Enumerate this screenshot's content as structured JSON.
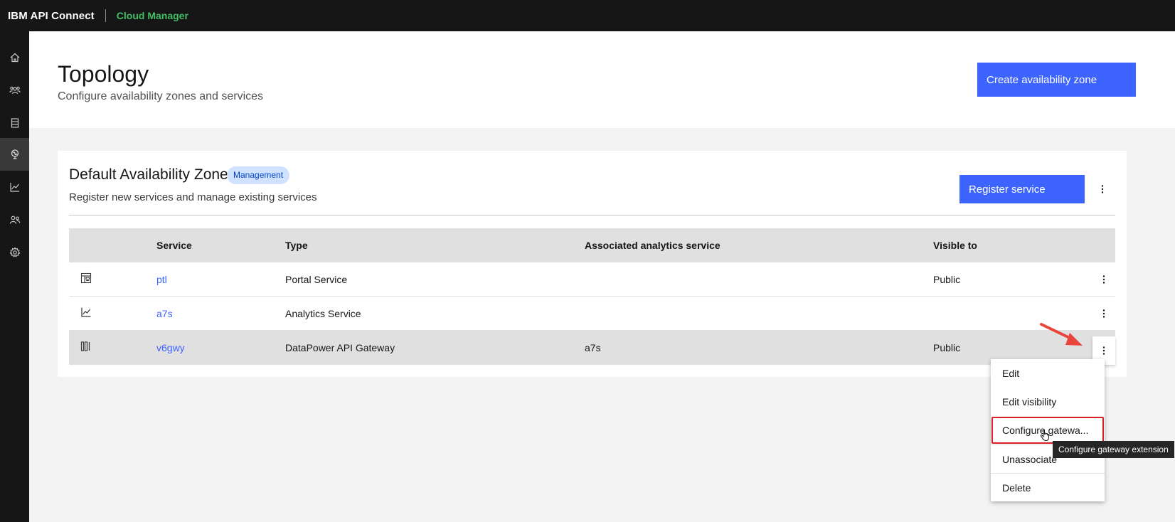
{
  "topbar": {
    "brand": "IBM API Connect",
    "app_name": "Cloud Manager"
  },
  "sidenav": {
    "items": [
      {
        "name": "home-icon",
        "active": false
      },
      {
        "name": "organizations-icon",
        "active": false
      },
      {
        "name": "resources-icon",
        "active": false
      },
      {
        "name": "topology-icon",
        "active": true
      },
      {
        "name": "analytics-icon",
        "active": false
      },
      {
        "name": "members-icon",
        "active": false
      },
      {
        "name": "settings-icon",
        "active": false
      }
    ]
  },
  "header": {
    "title": "Topology",
    "subtitle": "Configure availability zones and services",
    "create_button": "Create availability zone"
  },
  "zone": {
    "title": "Default Availability Zone",
    "tag": "Management",
    "description": "Register new services and manage existing services",
    "register_button": "Register service"
  },
  "table": {
    "headers": [
      "Service",
      "Type",
      "Associated analytics service",
      "Visible to"
    ],
    "rows": [
      {
        "icon": "portal-icon",
        "service": "ptl",
        "type": "Portal Service",
        "analytics": "",
        "visible": "Public"
      },
      {
        "icon": "analytics-chart-icon",
        "service": "a7s",
        "type": "Analytics Service",
        "analytics": "",
        "visible": ""
      },
      {
        "icon": "gateway-icon",
        "service": "v6gwy",
        "type": "DataPower API Gateway",
        "analytics": "a7s",
        "visible": "Public"
      }
    ]
  },
  "menu": {
    "items": [
      "Edit",
      "Edit visibility",
      "Configure gatewa...",
      "Unassociate",
      "Delete"
    ]
  },
  "tooltip": "Configure gateway extension",
  "colors": {
    "primary": "#3e64ff",
    "accent_green": "#42be65",
    "highlight": "#da1e28",
    "arrow": "#e8453c"
  }
}
